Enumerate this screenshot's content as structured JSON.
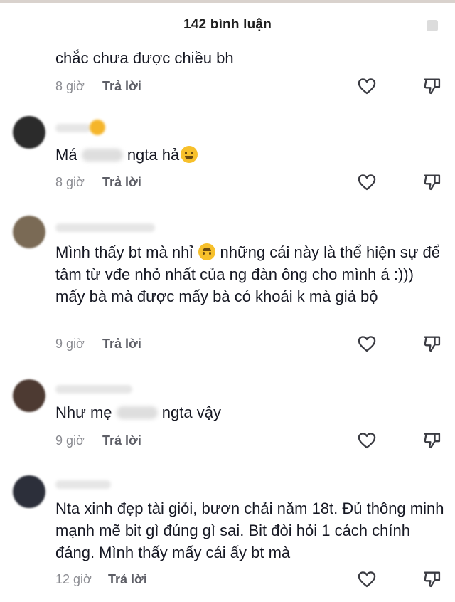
{
  "header": {
    "title": "142 bình luận"
  },
  "comments": [
    {
      "text": "chắc chưa được chiều bh",
      "time": "8 giờ",
      "reply": "Trả lời"
    },
    {
      "text_before": "Má",
      "text_after": "ngta hả",
      "emoji": "grinning-sweat-emoji",
      "time": "8 giờ",
      "reply": "Trả lời"
    },
    {
      "text_before": "Mình thấy bt mà nhỉ",
      "text_after": "những cái này là thể hiện sự để tâm từ vđe nhỏ nhất của ng đàn ông cho mình á :))) mấy bà mà được mấy bà có khoái k mà giả bộ",
      "emoji": "upside-down-face-emoji",
      "time": "9 giờ",
      "reply": "Trả lời"
    },
    {
      "text_before": "Như mẹ",
      "text_after": "ngta vậy",
      "time": "9 giờ",
      "reply": "Trả lời"
    },
    {
      "text": "Nta xinh đẹp tài giỏi, bươn chải năm 18t. Đủ thông minh mạnh mẽ bit gì đúng gì sai. Bit đòi hỏi 1 cách chính đáng. Mình thấy mấy cái ấy bt mà",
      "time": "12 giờ",
      "reply": "Trả lời"
    }
  ],
  "icons": {
    "like": "heart-outline-icon",
    "dislike": "thumbs-down-outline-icon",
    "close": "close-icon"
  },
  "colors": {
    "text": "#161823",
    "meta": "#8a8b91",
    "reply": "#5d5e66"
  }
}
